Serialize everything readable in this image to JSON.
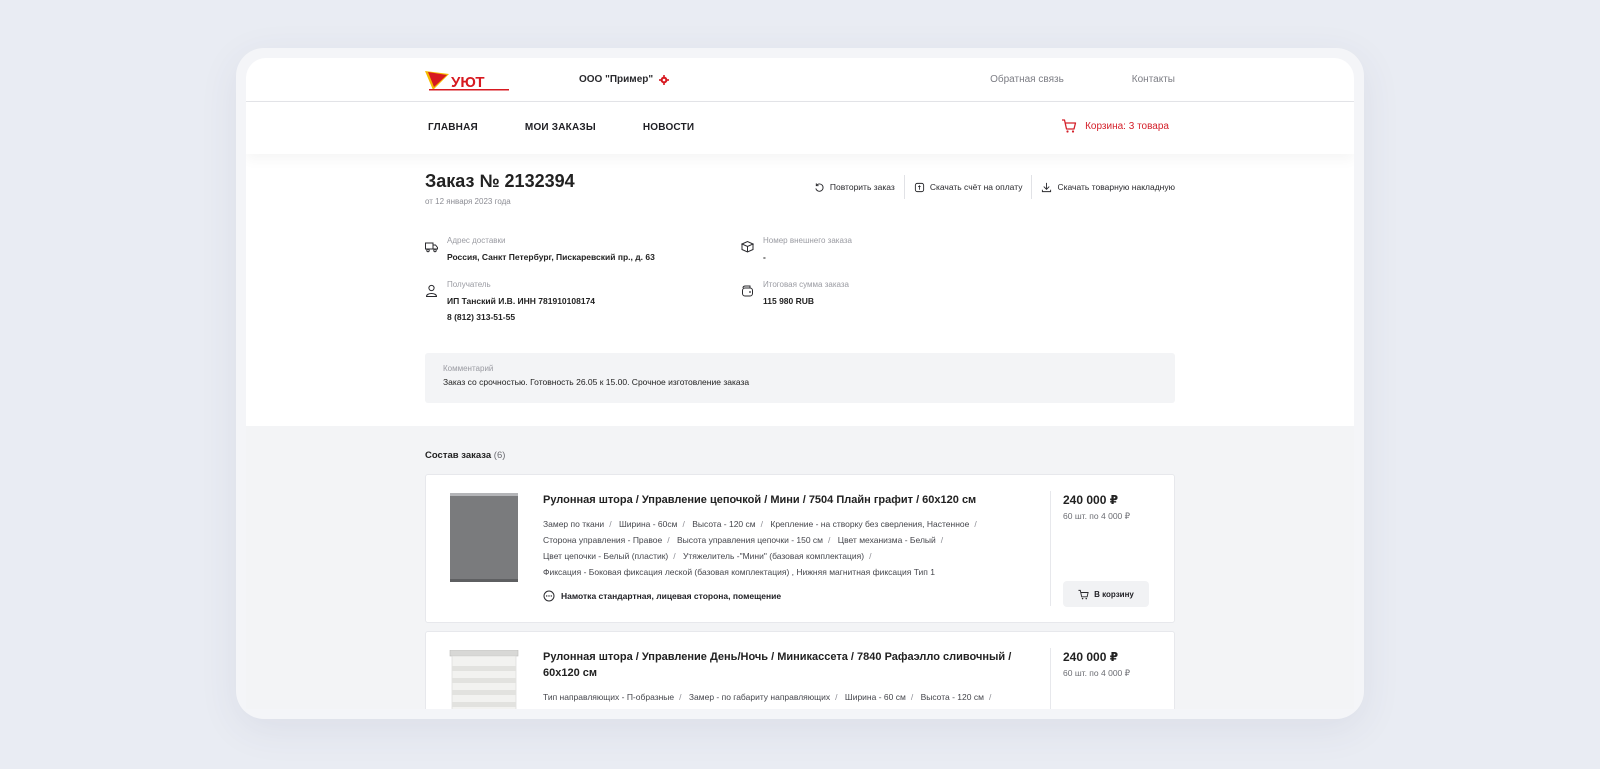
{
  "header": {
    "logo_text": "УЮТ",
    "company": "ООО \"Пример\"",
    "links": [
      "Обратная связь",
      "Контакты"
    ]
  },
  "nav": {
    "items": [
      "ГЛАВНАЯ",
      "МОИ ЗАКАЗЫ",
      "НОВОСТИ"
    ],
    "cart": "Корзина: 3 товара"
  },
  "order": {
    "title": "Заказ № 2132394",
    "date": "от 12 января 2023 года",
    "actions": [
      "Повторить заказ",
      "Скачать счёт на оплату",
      "Скачать товарную накладную"
    ],
    "delivery": {
      "label": "Адрес доставки",
      "value": "Россия, Санкт Петербург, Пискаревский пр., д. 63"
    },
    "external": {
      "label": "Номер внешнего заказа",
      "value": "-"
    },
    "recipient": {
      "label": "Получатель",
      "value": "ИП Танский И.В.  ИНН 781910108174",
      "phone": "8 (812) 313-51-55"
    },
    "total": {
      "label": "Итоговая сумма заказа",
      "value": "115 980 RUB"
    },
    "comment": {
      "label": "Комментарий",
      "value": "Заказ со срочностью. Готовность 26.05 к 15.00. Срочное изготовление заказа"
    }
  },
  "composition": {
    "title": "Состав заказа",
    "count": "(6)",
    "items": [
      {
        "name": "Рулонная штора / Управление цепочкой / Мини / 7504 Плайн графит / 60x120 см",
        "specs": [
          "Замер по ткани",
          "Ширина - 60см",
          "Высота - 120 см",
          "Крепление - на створку без сверления, Настенное",
          "Сторона управления - Правое",
          "Высота управления цепочки - 150 см",
          "Цвет механизма - Белый",
          "Цвет цепочки - Белый (пластик)",
          "Утяжелитель -\"Мини\" (базовая комплектация)",
          "Фиксация - Боковая фиксация леской (базовая комплектация)  , Нижняя магнитная  фиксация Тип 1"
        ],
        "note": "Намотка стандартная, лицевая сторона, помещение",
        "price": "240 000 ₽",
        "qty": "60 шт. по 4 000 ₽",
        "button": "В корзину",
        "thumb_color": "#7a7b7d"
      },
      {
        "name": "Рулонная штора / Управление День/Ночь / Миникассета / 7840 Рафаэлло сливочный / 60x120 см",
        "specs": [
          "Тип направляющих - П-образные",
          "Замер - по габариту направляющих",
          "Ширина - 60 см",
          "Высота - 120 см"
        ],
        "price": "240 000 ₽",
        "qty": "60 шт. по 4 000 ₽",
        "thumb_color": "#f2f2f0"
      }
    ]
  }
}
